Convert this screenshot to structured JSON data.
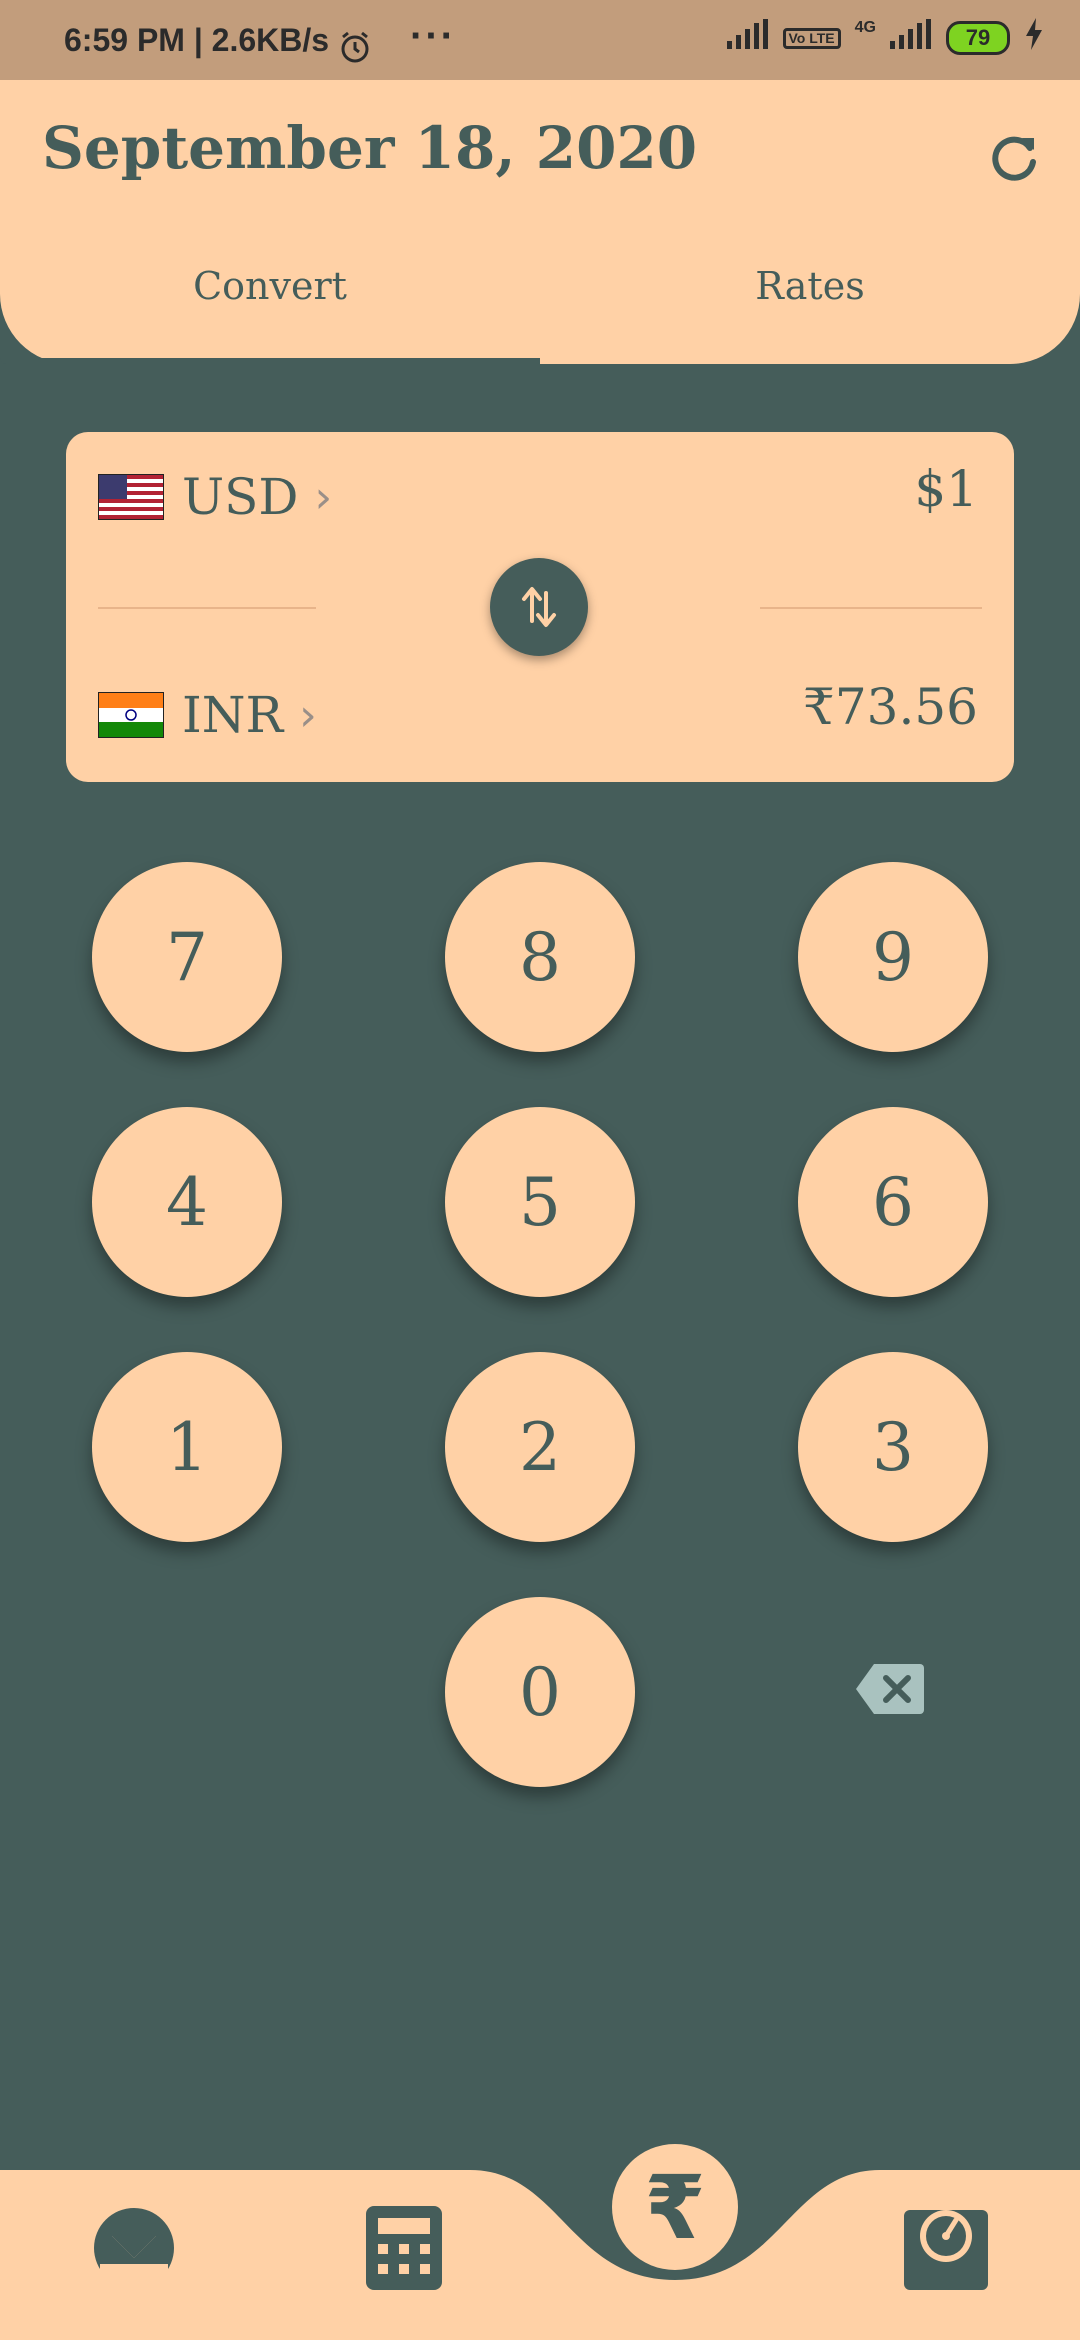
{
  "status_bar": {
    "time": "6:59 PM | 2.6KB/s",
    "more": "···",
    "volte": "Vo LTE",
    "network": "4G",
    "battery": "79"
  },
  "header": {
    "date": "September 18, 2020",
    "tabs": [
      {
        "label": "Convert",
        "selected": true
      },
      {
        "label": "Rates",
        "selected": false
      }
    ]
  },
  "converter": {
    "from": {
      "code": "USD",
      "amount": "$1",
      "flag": "us-flag"
    },
    "to": {
      "code": "INR",
      "amount": "₹73.56",
      "flag": "india-flag"
    }
  },
  "keypad": {
    "keys": [
      "7",
      "8",
      "9",
      "4",
      "5",
      "6",
      "1",
      "2",
      "3",
      "0"
    ]
  },
  "bottom_nav": {
    "items": [
      {
        "icon": "monero-icon"
      },
      {
        "icon": "calculator-icon"
      },
      {
        "icon": "rupee-icon",
        "label": "₹",
        "active": true
      },
      {
        "icon": "speedometer-icon"
      }
    ]
  },
  "colors": {
    "accent": "#ffd1a6",
    "background": "#455d5a",
    "status_bar": "#c29d7c"
  }
}
